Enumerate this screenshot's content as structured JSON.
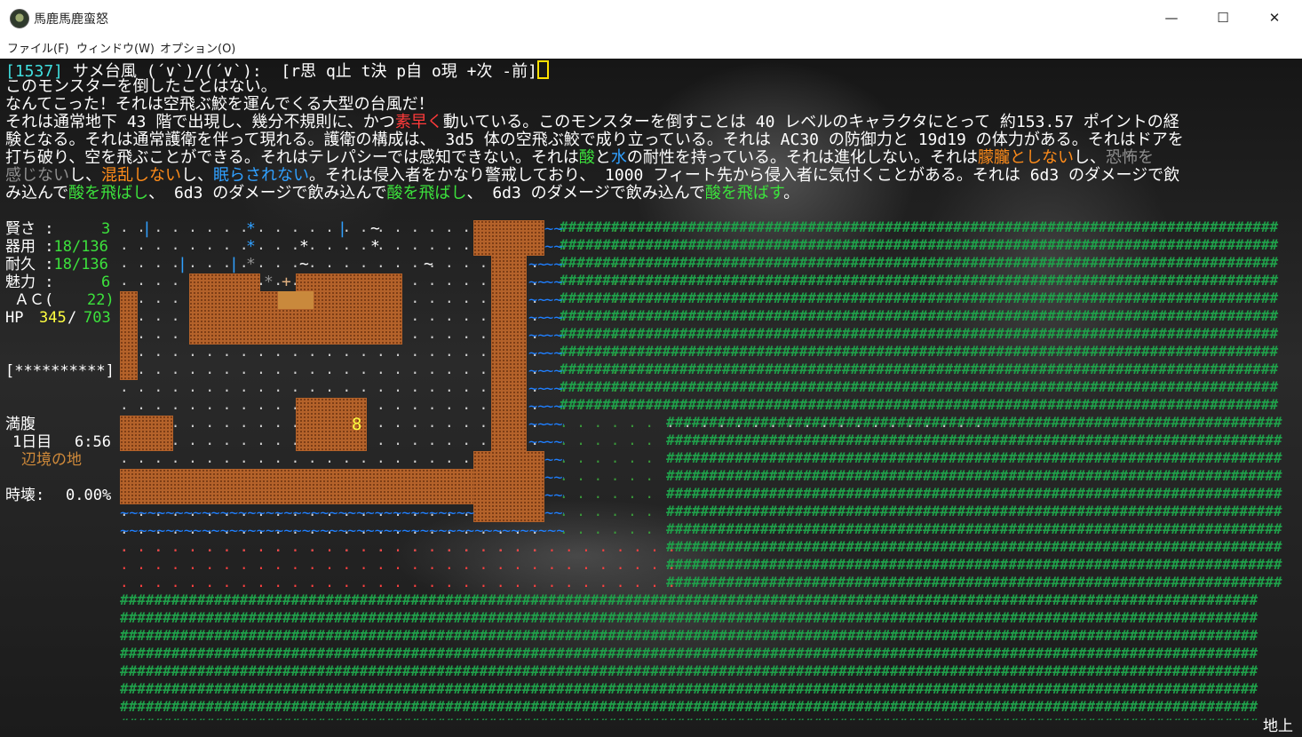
{
  "window": {
    "title": "馬鹿馬鹿蛮怒",
    "minimize": "—",
    "maximize": "☐",
    "close": "✕"
  },
  "menu": {
    "items": [
      "ファイル(F)",
      "ウィンドウ(W)",
      "オプション(O)"
    ]
  },
  "prompt": {
    "index": "[1537]",
    "monster": " サメ台風 (´∨`)/(´∨`): ",
    "commands": " [r思 q止 t決 p自 o現 +次 -前]"
  },
  "recall": {
    "l1": "このモンスターを倒したことはない。",
    "l2": "なんてこった！それは空飛ぶ鮫を運んでくる大型の台風だ！",
    "l3a": "それは通常地下 43 階で出現し、幾分不規則に、かつ",
    "l3b": "素早く",
    "l3c": "動いている。このモンスターを倒すことは 40 レベルのキャラクタにとって 約153.57 ポイントの経",
    "l4": "験となる。それは通常護衛を伴って現れる。護衛の構成は、 3d5 体の空飛ぶ鮫で成り立っている。それは AC30 の防御力と 19d19 の体力がある。それはドアを",
    "l5a": "打ち破り、空を飛ぶことができる。それはテレパシーでは感知できない。それは",
    "l5b": "酸",
    "l5c": "と",
    "l5d": "水",
    "l5e": "の耐性を持っている。それは進化しない。それは",
    "l5f": "朦朧としない",
    "l5g": "し、",
    "l5h": "恐怖を",
    "l6a": "感じない",
    "l6b": "し、",
    "l6c": "混乱しない",
    "l6d": "し、",
    "l6e": "眠らされない",
    "l6f": "。それは侵入者をかなり警戒しており、 1000 フィート先から侵入者に気付くことがある。それは 6d3 のダメージで飲",
    "l7a": "み込んで",
    "l7b": "酸を飛ばし",
    "l7c": "、 6d3 のダメージで飲み込んで",
    "l7d": "酸を飛ばし",
    "l7e": "、 6d3 のダメージで飲み込んで",
    "l7f": "酸を飛ばす",
    "l7g": "。"
  },
  "stats": {
    "int_label": "賢さ :",
    "int_value": "3",
    "dex_label": "器用 :",
    "dex_value": "18/136",
    "con_label": "耐久 :",
    "con_value": "18/136",
    "chr_label": "魅力 :",
    "chr_value": "6",
    "ac_label": "ＡＣ(",
    "ac_value": "22)",
    "hp_label": "HP",
    "hp_cur": "345",
    "hp_sep": "/",
    "hp_max": "703",
    "health_bar": "[**********]",
    "hunger": "満腹",
    "day": "1日目",
    "time": "6:56",
    "terrain": "辺境の地",
    "time_decay_label": "時壊:",
    "time_decay_value": "0.00%"
  },
  "map": {
    "player": "8",
    "rubble": "*",
    "door": "+",
    "tree_mark": "|",
    "hill": "~",
    "hash": "#",
    "dot": "."
  },
  "status_bar": {
    "location": "地上"
  },
  "colors": {
    "wall": "#b4622a",
    "water": "#1f7fff",
    "forest": "#1fa04a",
    "player": "#ffff40"
  }
}
